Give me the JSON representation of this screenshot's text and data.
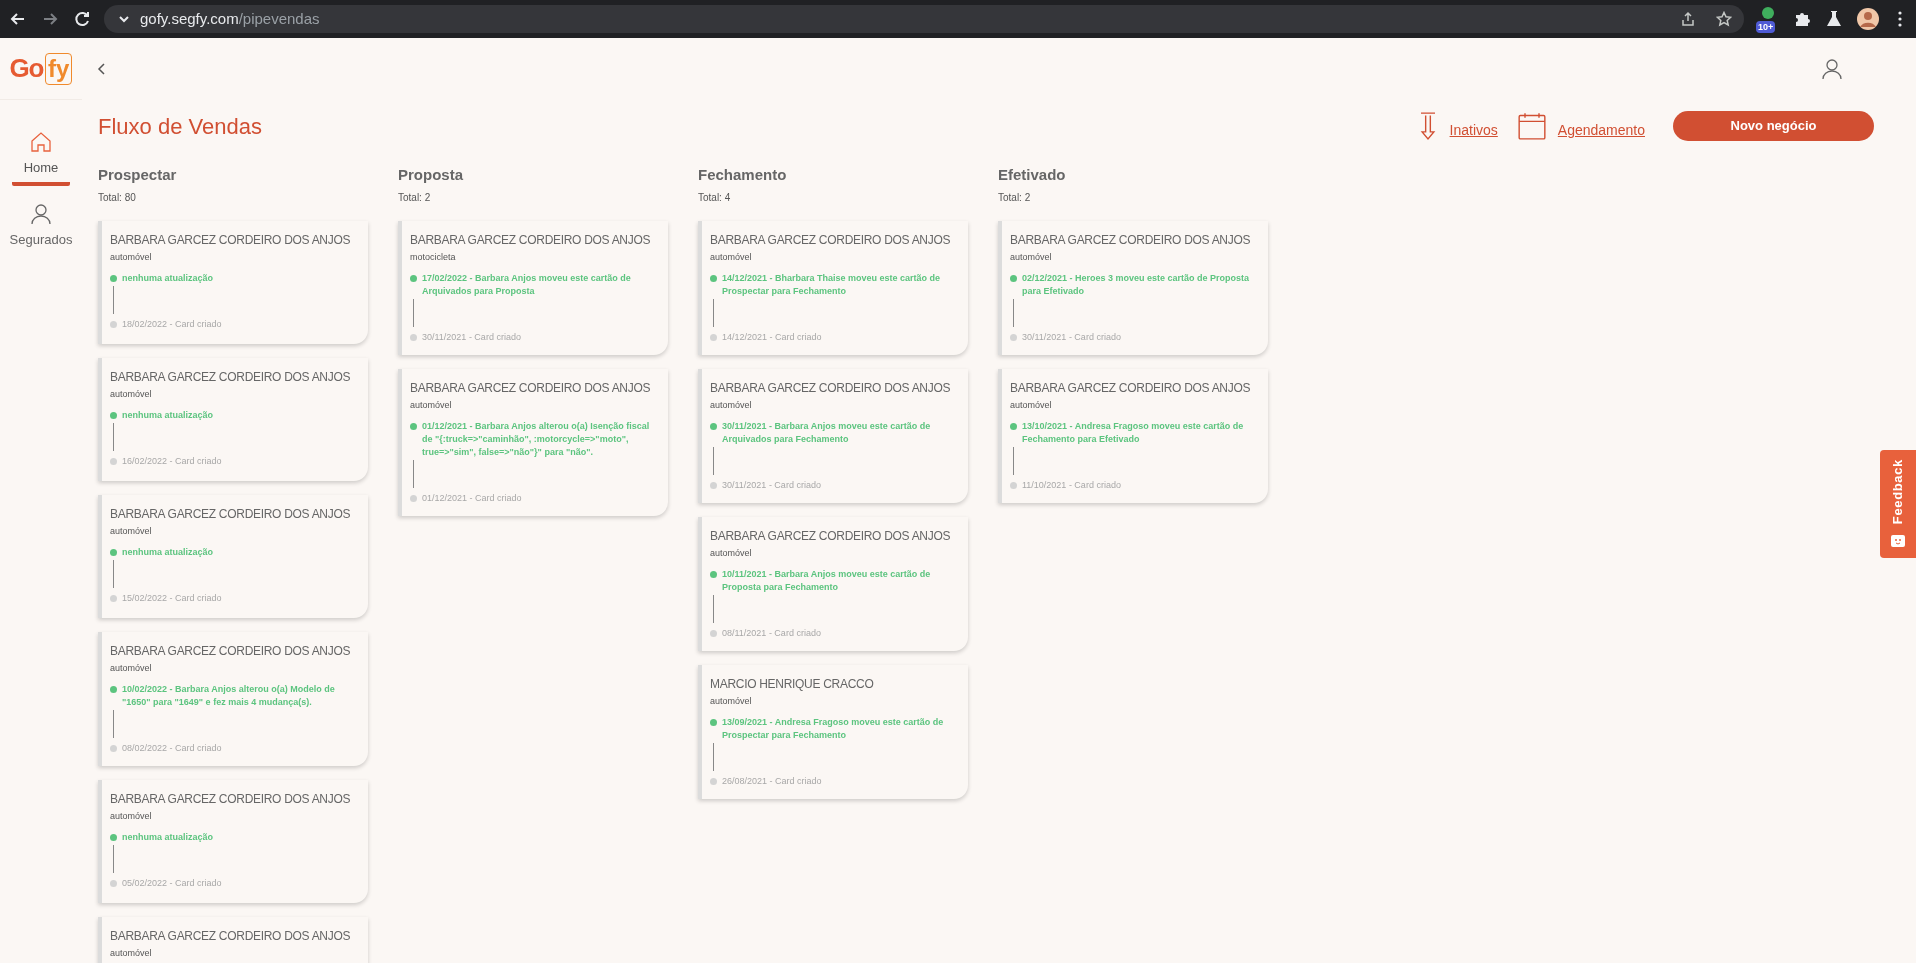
{
  "browser": {
    "url_host": "gofy.segfy.com",
    "url_path": "/pipevendas",
    "extension_badge": "10+"
  },
  "logo": {
    "part_1": "Go",
    "part_2": "fy"
  },
  "sidebar": {
    "items": [
      {
        "label": "Home",
        "kind": "home",
        "selected": true
      },
      {
        "label": "Segurados",
        "kind": "person",
        "selected": false
      }
    ]
  },
  "page": {
    "title": "Fluxo de Vendas"
  },
  "actions": {
    "links": [
      {
        "label": "Inativos",
        "kind": "download"
      },
      {
        "label": "Agendamento",
        "kind": "calendar"
      }
    ],
    "primary_button": "Novo negócio"
  },
  "columns": [
    {
      "title": "Prospectar",
      "total": "Total: 80",
      "cards": [
        {
          "name": "BARBARA GARCEZ CORDEIRO DOS ANJOS",
          "product": "automóvel",
          "update": "nenhuma atualização",
          "created": "18/02/2022 - Card criado"
        },
        {
          "name": "BARBARA GARCEZ CORDEIRO DOS ANJOS",
          "product": "automóvel",
          "update": "nenhuma atualização",
          "created": "16/02/2022 - Card criado"
        },
        {
          "name": "BARBARA GARCEZ CORDEIRO DOS ANJOS",
          "product": "automóvel",
          "update": "nenhuma atualização",
          "created": "15/02/2022 - Card criado"
        },
        {
          "name": "BARBARA GARCEZ CORDEIRO DOS ANJOS",
          "product": "automóvel",
          "update": "10/02/2022 - Barbara Anjos alterou o(a) Modelo de \"1650\" para \"1649\" e fez mais 4 mudança(s).",
          "created": "08/02/2022 - Card criado"
        },
        {
          "name": "BARBARA GARCEZ CORDEIRO DOS ANJOS",
          "product": "automóvel",
          "update": "nenhuma atualização",
          "created": "05/02/2022 - Card criado"
        },
        {
          "name": "BARBARA GARCEZ CORDEIRO DOS ANJOS",
          "product": "automóvel"
        }
      ]
    },
    {
      "title": "Proposta",
      "total": "Total: 2",
      "cards": [
        {
          "name": "BARBARA GARCEZ CORDEIRO DOS ANJOS",
          "product": "motocicleta",
          "update": "17/02/2022 - Barbara Anjos moveu este cartão de Arquivados para Proposta",
          "created": "30/11/2021 - Card criado"
        },
        {
          "name": "BARBARA GARCEZ CORDEIRO DOS ANJOS",
          "product": "automóvel",
          "update": "01/12/2021 - Barbara Anjos alterou o(a) Isenção fiscal de \"{:truck=>\"caminhão\", :motorcycle=>\"moto\", true=>\"sim\", false=>\"não\"}\" para \"não\".",
          "created": "01/12/2021 - Card criado"
        }
      ]
    },
    {
      "title": "Fechamento",
      "total": "Total: 4",
      "cards": [
        {
          "name": "BARBARA GARCEZ CORDEIRO DOS ANJOS",
          "product": "automóvel",
          "update": "14/12/2021 - Bharbara Thaise moveu este cartão de Prospectar para Fechamento",
          "created": "14/12/2021 - Card criado"
        },
        {
          "name": "BARBARA GARCEZ CORDEIRO DOS ANJOS",
          "product": "automóvel",
          "update": "30/11/2021 - Barbara Anjos moveu este cartão de Arquivados para Fechamento",
          "created": "30/11/2021 - Card criado"
        },
        {
          "name": "BARBARA GARCEZ CORDEIRO DOS ANJOS",
          "product": "automóvel",
          "update": "10/11/2021 - Barbara Anjos moveu este cartão de Proposta para Fechamento",
          "created": "08/11/2021 - Card criado"
        },
        {
          "name": "MARCIO HENRIQUE CRACCO",
          "product": "automóvel",
          "update": "13/09/2021 - Andresa Fragoso moveu este cartão de Prospectar para Fechamento",
          "created": "26/08/2021 - Card criado"
        }
      ]
    },
    {
      "title": "Efetivado",
      "total": "Total: 2",
      "cards": [
        {
          "name": "BARBARA GARCEZ CORDEIRO DOS ANJOS",
          "product": "automóvel",
          "update": "02/12/2021 - Heroes 3 moveu este cartão de Proposta para Efetivado",
          "created": "30/11/2021 - Card criado"
        },
        {
          "name": "BARBARA GARCEZ CORDEIRO DOS ANJOS",
          "product": "automóvel",
          "update": "13/10/2021 - Andresa Fragoso moveu este cartão de Fechamento para Efetivado",
          "created": "11/10/2021 - Card criado"
        }
      ]
    }
  ],
  "feedback_tab": {
    "label": "Feedback"
  }
}
